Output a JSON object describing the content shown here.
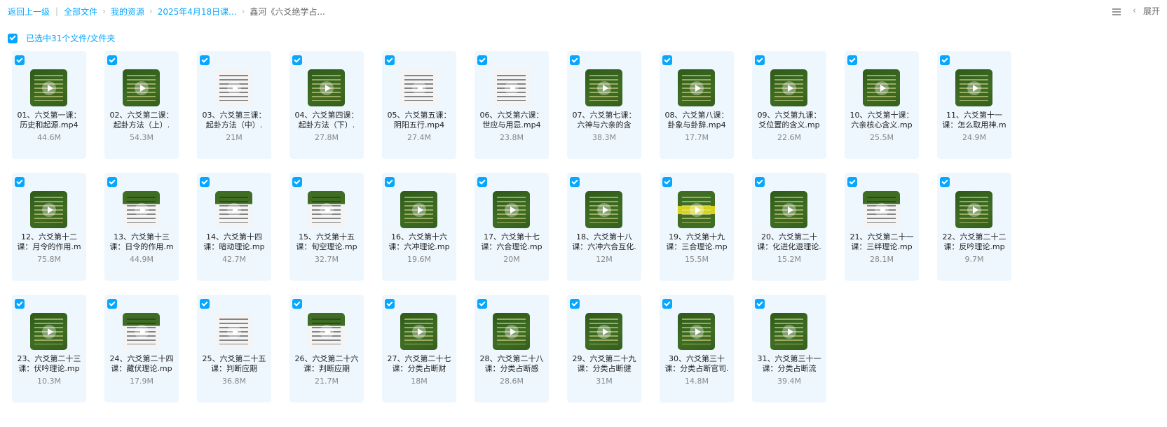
{
  "breadcrumb": {
    "back": "返回上一级",
    "items": [
      "全部文件",
      "我的资源",
      "2025年4月18日课...",
      "鑫河《六爻绝学占..."
    ]
  },
  "tools": {
    "expand_label": "展开",
    "list_icon": "list-view-icon",
    "chevron_icon": "chevron-left-icon"
  },
  "selection": {
    "text": "已选中31个文件/文件夹"
  },
  "accent": "#06a7ff",
  "files": [
    {
      "name": "01、六爻第一课：历史和起源.mp4",
      "size": "44.6M",
      "thumb": "green"
    },
    {
      "name": "02、六爻第二课：起卦方法（上）.",
      "size": "54.3M",
      "thumb": "green"
    },
    {
      "name": "03、六爻第三课：起卦方法（中）.",
      "size": "21M",
      "thumb": "white"
    },
    {
      "name": "04、六爻第四课：起卦方法（下）.",
      "size": "27.8M",
      "thumb": "green"
    },
    {
      "name": "05、六爻第五课：阴阳五行.mp4",
      "size": "27.4M",
      "thumb": "white"
    },
    {
      "name": "06、六爻第六课：世应与用忌.mp4",
      "size": "23.8M",
      "thumb": "white"
    },
    {
      "name": "07、六爻第七课：六神与六亲的含",
      "size": "38.3M",
      "thumb": "green"
    },
    {
      "name": "08、六爻第八课：卦象与卦辞.mp4",
      "size": "17.7M",
      "thumb": "green"
    },
    {
      "name": "09、六爻第九课：爻位置的含义.mp",
      "size": "22.6M",
      "thumb": "green"
    },
    {
      "name": "10、六爻第十课：六亲核心含义.mp",
      "size": "25.5M",
      "thumb": "green"
    },
    {
      "name": "11、六爻第十一课：怎么取用神.m",
      "size": "24.9M",
      "thumb": "green"
    },
    {
      "name": "12、六爻第十二课：月令的作用.m",
      "size": "75.8M",
      "thumb": "green"
    },
    {
      "name": "13、六爻第十三课：日令的作用.m",
      "size": "44.9M",
      "thumb": "mixed"
    },
    {
      "name": "14、六爻第十四课：暗动理论.mp",
      "size": "42.7M",
      "thumb": "mixed"
    },
    {
      "name": "15、六爻第十五课：旬空理论.mp",
      "size": "32.7M",
      "thumb": "mixed"
    },
    {
      "name": "16、六爻第十六课：六冲理论.mp",
      "size": "19.6M",
      "thumb": "green"
    },
    {
      "name": "17、六爻第十七课：六合理论.mp",
      "size": "20M",
      "thumb": "green"
    },
    {
      "name": "18、六爻第十八课：六冲六合互化.",
      "size": "12M",
      "thumb": "green"
    },
    {
      "name": "19、六爻第十九课：三合理论.mp",
      "size": "15.5M",
      "thumb": "yellow"
    },
    {
      "name": "20、六爻第二十课：化进化退理论.",
      "size": "15.2M",
      "thumb": "green"
    },
    {
      "name": "21、六爻第二十一课：三绊理论.mp",
      "size": "28.1M",
      "thumb": "mixed"
    },
    {
      "name": "22、六爻第二十二课：反吟理论.mp",
      "size": "9.7M",
      "thumb": "green"
    },
    {
      "name": "23、六爻第二十三课：伏吟理论.mp",
      "size": "10.3M",
      "thumb": "green"
    },
    {
      "name": "24、六爻第二十四课：藏伏理论.mp",
      "size": "17.9M",
      "thumb": "mixed"
    },
    {
      "name": "25、六爻第二十五课：判断应期",
      "size": "36.8M",
      "thumb": "white"
    },
    {
      "name": "26、六爻第二十六课：判断应期",
      "size": "21.7M",
      "thumb": "mixed"
    },
    {
      "name": "27、六爻第二十七课：分类占断财",
      "size": "18M",
      "thumb": "green"
    },
    {
      "name": "28、六爻第二十八课：分类占断感",
      "size": "28.6M",
      "thumb": "green"
    },
    {
      "name": "29、六爻第二十九课：分类占断健",
      "size": "31M",
      "thumb": "green"
    },
    {
      "name": "30、六爻第三十课：分类占断官司.",
      "size": "14.8M",
      "thumb": "green"
    },
    {
      "name": "31、六爻第三十一课：分类占断流",
      "size": "39.4M",
      "thumb": "green"
    }
  ]
}
